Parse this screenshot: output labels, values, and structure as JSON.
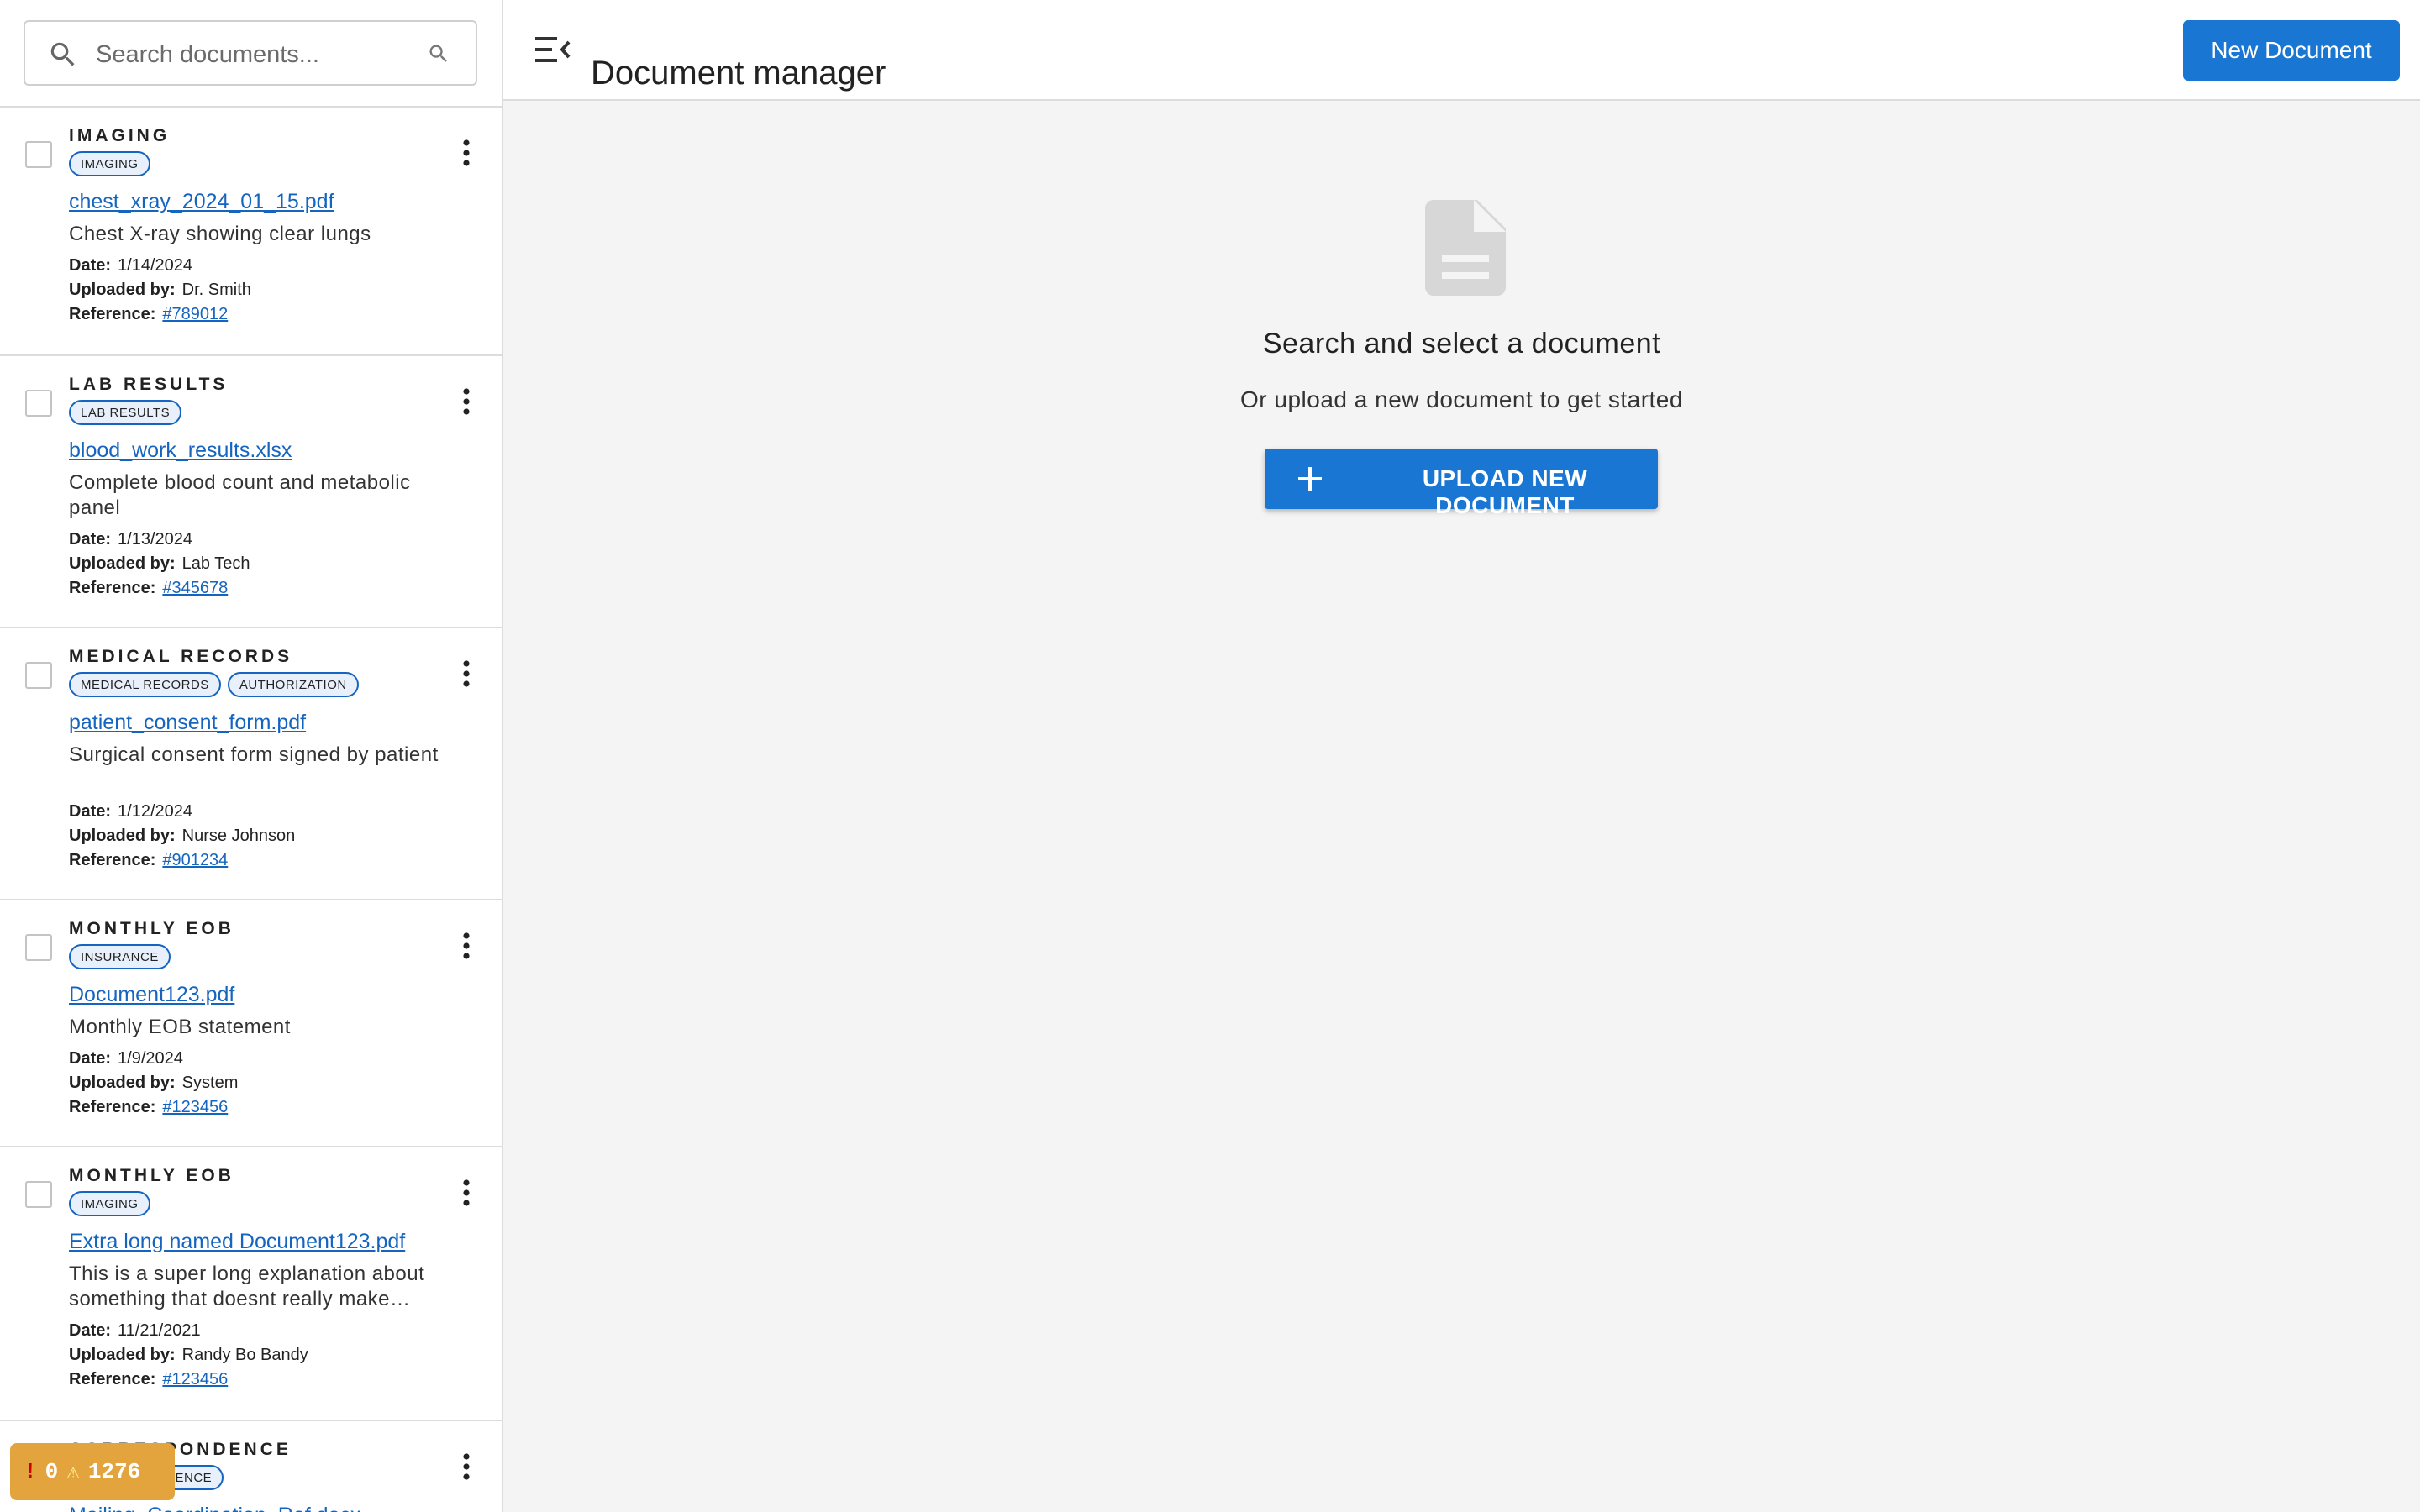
{
  "search": {
    "placeholder": "Search documents..."
  },
  "header": {
    "title": "Document manager",
    "new_button": "New Document"
  },
  "empty_state": {
    "title": "Search and select a document",
    "subtitle": "Or upload a new document to get started",
    "upload_button": "UPLOAD NEW DOCUMENT"
  },
  "labels": {
    "date": "Date:",
    "uploaded_by": "Uploaded by:",
    "reference": "Reference:"
  },
  "documents": [
    {
      "category": "IMAGING",
      "tags": [
        "IMAGING"
      ],
      "filename": "chest_xray_2024_01_15.pdf",
      "description": "Chest X-ray showing clear lungs",
      "date": "1/14/2024",
      "uploaded_by": "Dr. Smith",
      "reference": "#789012"
    },
    {
      "category": "LAB RESULTS",
      "tags": [
        "LAB RESULTS"
      ],
      "filename": "blood_work_results.xlsx",
      "description": "Complete blood count and metabolic panel",
      "date": "1/13/2024",
      "uploaded_by": "Lab Tech",
      "reference": "#345678"
    },
    {
      "category": "MEDICAL RECORDS",
      "tags": [
        "MEDICAL RECORDS",
        "AUTHORIZATION"
      ],
      "filename": "patient_consent_form.pdf",
      "description": "Surgical consent form signed by patient",
      "date": "1/12/2024",
      "uploaded_by": "Nurse Johnson",
      "reference": "#901234"
    },
    {
      "category": "MONTHLY EOB",
      "tags": [
        "INSURANCE"
      ],
      "filename": "Document123.pdf",
      "description": "Monthly EOB statement",
      "date": "1/9/2024",
      "uploaded_by": "System",
      "reference": "#123456"
    },
    {
      "category": "MONTHLY EOB",
      "tags": [
        "IMAGING"
      ],
      "filename": "Extra long named Document123.pdf",
      "description": "This is a super long explanation about something that doesnt really make…",
      "date": "11/21/2021",
      "uploaded_by": "Randy Bo Bandy",
      "reference": "#123456"
    },
    {
      "category": "CORRESPONDENCE",
      "tags": [
        "CORRESPONDENCE"
      ],
      "filename": "Mailing_Coordination_Ref.docx",
      "description": "",
      "date": "",
      "uploaded_by": "",
      "reference": ""
    }
  ],
  "dev_badge": {
    "errors": "0",
    "warnings": "1276"
  },
  "colors": {
    "primary": "#1976d2",
    "link": "#1565c0",
    "badge": "#e3a33d"
  }
}
